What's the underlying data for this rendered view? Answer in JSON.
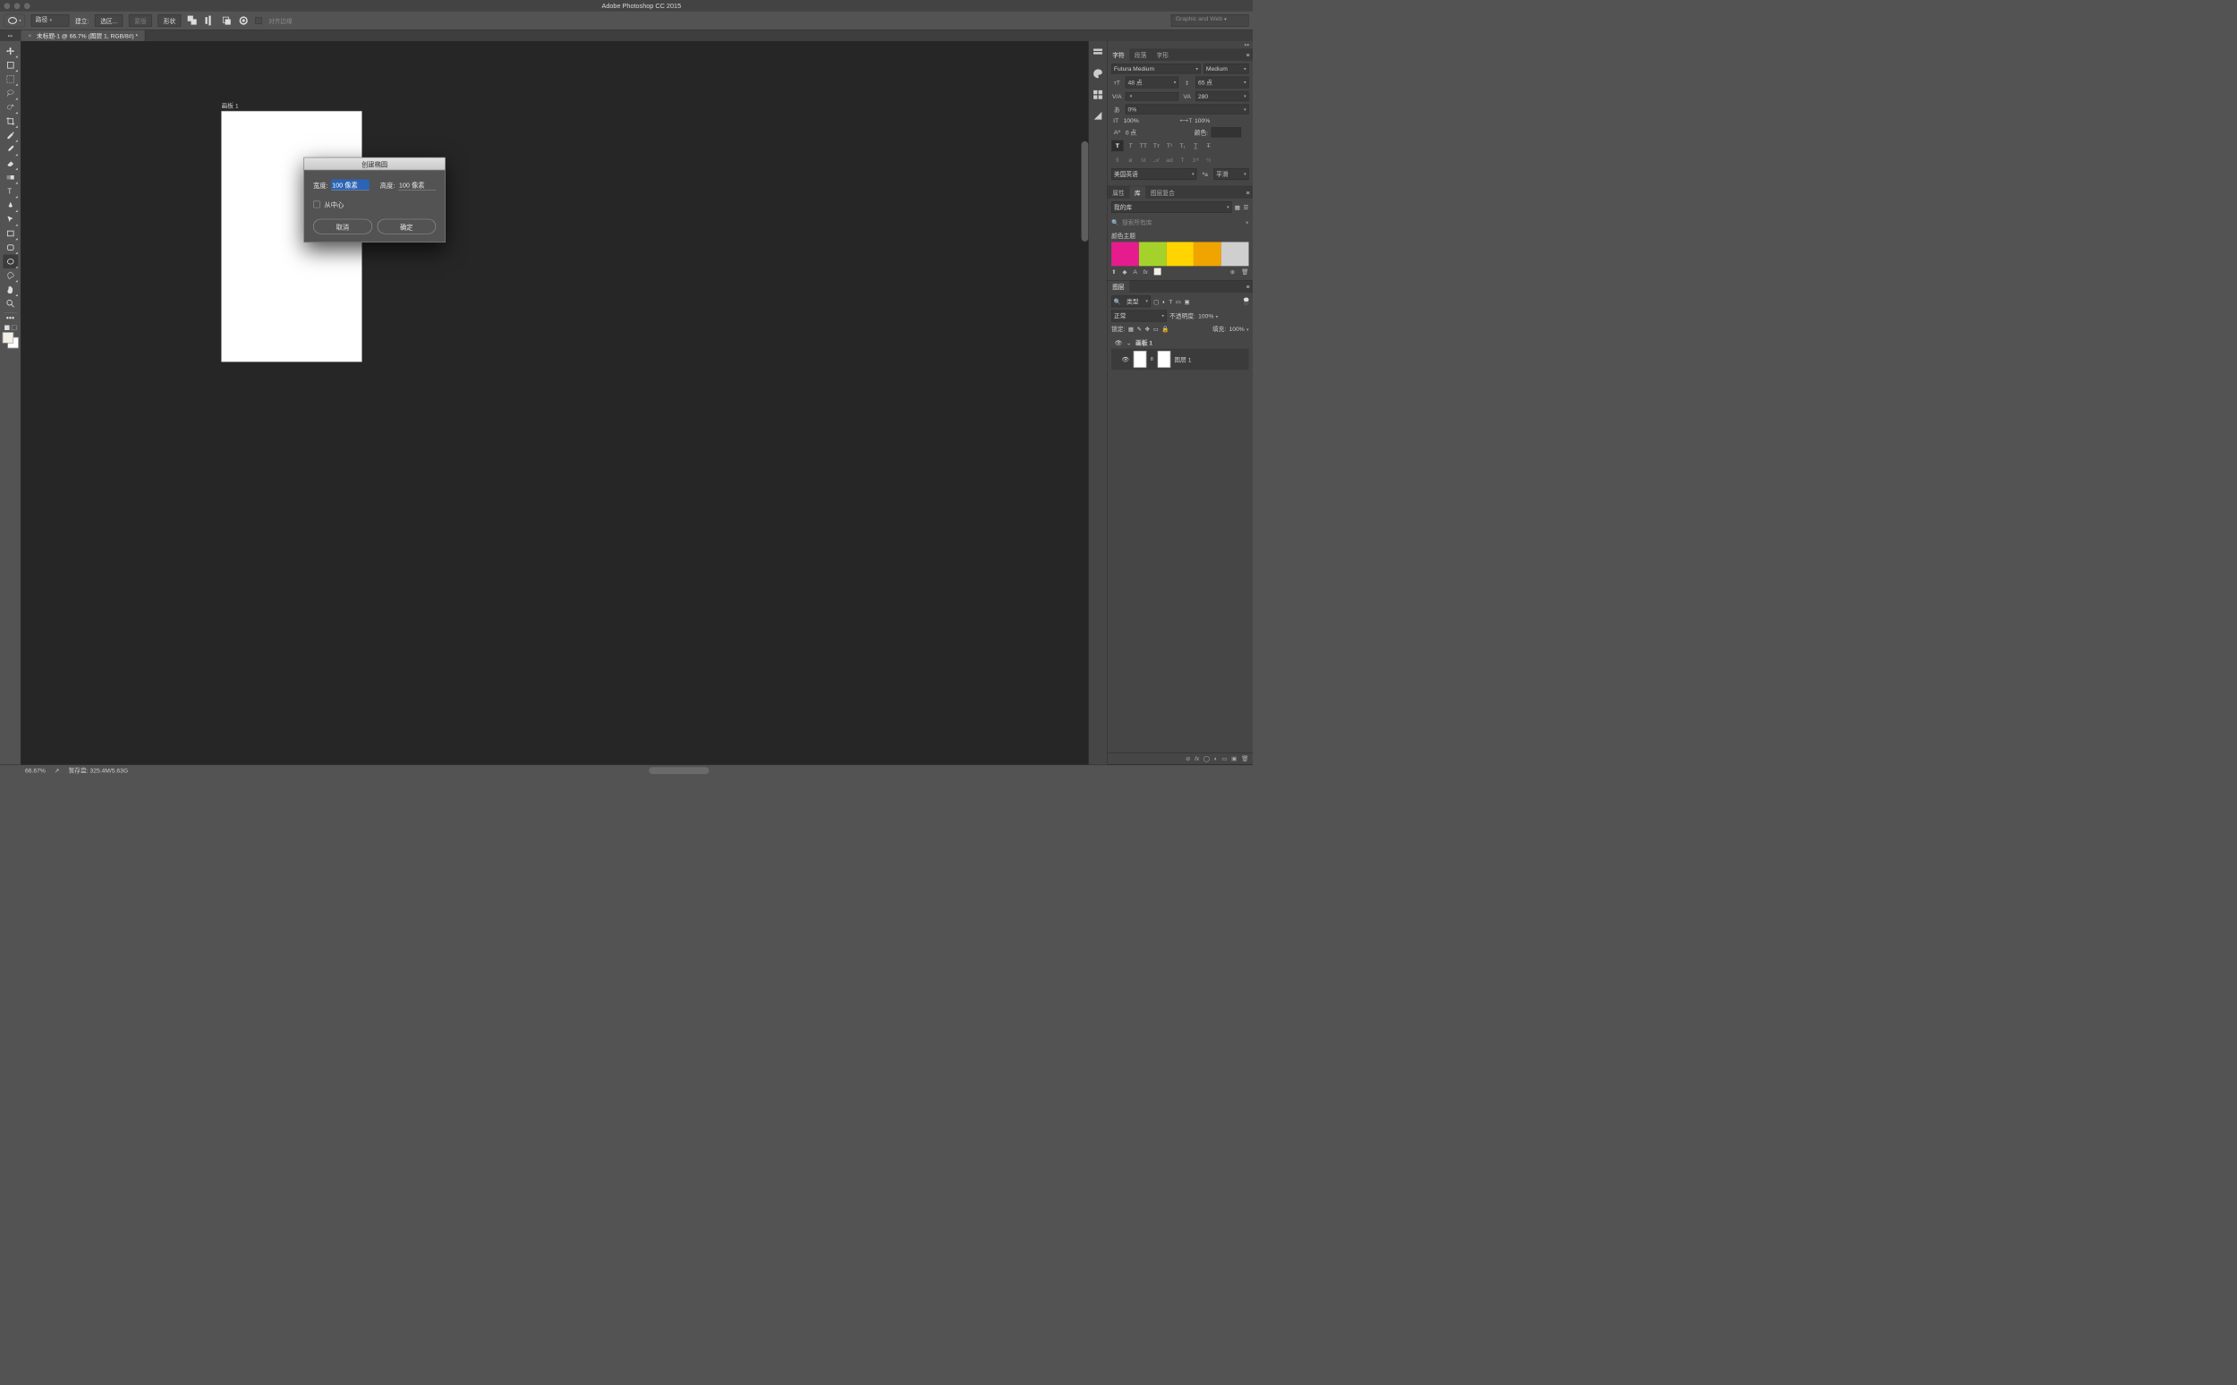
{
  "app_title": "Adobe Photoshop CC 2015",
  "optbar": {
    "path_mode": "路径",
    "make_label": "建立:",
    "selection_btn": "选区...",
    "mask_btn": "蒙版",
    "shape_btn": "形状",
    "align_edges": "对齐边缘",
    "preset": "Graphic and Web"
  },
  "file_tab": "未标题-1 @ 66.7% (图层 1, RGB/8#) *",
  "artboard_label": "画板 1",
  "dialog": {
    "title": "创建椭圆",
    "width_lbl": "宽度:",
    "width_val": "100 像素",
    "height_lbl": "高度:",
    "height_val": "100 像素",
    "from_center": "从中心",
    "cancel": "取消",
    "ok": "确定"
  },
  "char_panel": {
    "tabs": [
      "字符",
      "段落",
      "字形"
    ],
    "font": "Futura Medium",
    "weight": "Medium",
    "size": "48 点",
    "leading": "65 点",
    "kerning": "",
    "tracking": "280",
    "tsume": "0%",
    "vscale": "100%",
    "hscale": "100%",
    "baseline": "0 点",
    "color_lbl": "颜色:",
    "lang": "美国英语",
    "aa": "平滑"
  },
  "lib_panel": {
    "tabs": [
      "属性",
      "库",
      "图层复合"
    ],
    "my_lib": "我的库",
    "search_ph": "搜索所有库",
    "color_theme": "颜色主题",
    "swatches": [
      "#e61c8e",
      "#a5d22a",
      "#ffd400",
      "#f0a400",
      "#cfcfcf"
    ]
  },
  "layers_panel": {
    "title": "图层",
    "type_filter": "类型",
    "blend": "正常",
    "opacity_lbl": "不透明度:",
    "opacity": "100%",
    "lock_lbl": "锁定:",
    "fill_lbl": "填充:",
    "fill": "100%",
    "artboard": "画板 1",
    "layer1": "图层 1"
  },
  "status": {
    "zoom": "66.67%",
    "scratch": "暂存盘: 325.4M/5.63G"
  }
}
